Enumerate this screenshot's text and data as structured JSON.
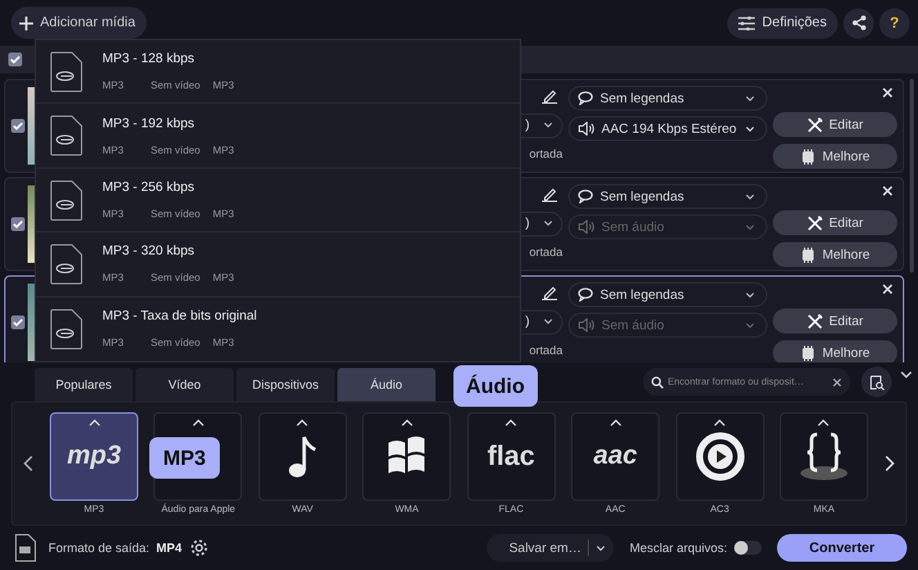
{
  "toolbar": {
    "add_button": "Adicionar mídia",
    "settings_button": "Definições",
    "help_button": "?"
  },
  "header": {
    "select_all_checked": true
  },
  "files": [
    {
      "checked": true,
      "selected": false,
      "video_partial": ")",
      "status_partial": "ortada",
      "subtitles": "Sem legendas",
      "audio": "AAC 194 Kbps Estéreo",
      "audio_disabled": false,
      "edit_button": "Editar",
      "enhance_button": "Melhore"
    },
    {
      "checked": true,
      "selected": false,
      "video_partial": ")",
      "status_partial": "ortada",
      "subtitles": "Sem legendas",
      "audio": "Sem áudio",
      "audio_disabled": true,
      "edit_button": "Editar",
      "enhance_button": "Melhore"
    },
    {
      "checked": true,
      "selected": true,
      "video_partial": ")",
      "status_partial": "ortada",
      "subtitles": "Sem legendas",
      "audio": "Sem áudio",
      "audio_disabled": true,
      "edit_button": "Editar",
      "enhance_button": "Melhore"
    }
  ],
  "preset_menu": [
    {
      "title": "MP3 - 128 kbps",
      "format": "MP3",
      "video": "Sem vídeo",
      "audio": "MP3"
    },
    {
      "title": "MP3 - 192 kbps",
      "format": "MP3",
      "video": "Sem vídeo",
      "audio": "MP3"
    },
    {
      "title": "MP3 - 256 kbps",
      "format": "MP3",
      "video": "Sem vídeo",
      "audio": "MP3"
    },
    {
      "title": "MP3 - 320 kbps",
      "format": "MP3",
      "video": "Sem vídeo",
      "audio": "MP3"
    },
    {
      "title": "MP3 - Taxa de bits original",
      "format": "MP3",
      "video": "Sem vídeo",
      "audio": "MP3"
    }
  ],
  "format_tabs": [
    {
      "label": "Populares",
      "selected": false
    },
    {
      "label": "Vídeo",
      "selected": false
    },
    {
      "label": "Dispositivos",
      "selected": false
    },
    {
      "label": "Áudio",
      "selected": true
    }
  ],
  "tab_tooltip": "Áudio",
  "search": {
    "placeholder": "Encontrar formato ou disposit…"
  },
  "formats": [
    {
      "label": "MP3",
      "kind": "logo",
      "logo_text": "mp3",
      "selected": true
    },
    {
      "label": "Áudio para Apple",
      "kind": "apple",
      "selected": false
    },
    {
      "label": "WAV",
      "kind": "note",
      "selected": false
    },
    {
      "label": "WMA",
      "kind": "windows",
      "selected": false
    },
    {
      "label": "FLAC",
      "kind": "logo",
      "logo_text": "flac",
      "selected": false
    },
    {
      "label": "AAC",
      "kind": "logo",
      "logo_text": "aac",
      "selected": false
    },
    {
      "label": "AC3",
      "kind": "play",
      "selected": false
    },
    {
      "label": "MKA",
      "kind": "braces",
      "selected": false
    }
  ],
  "format_tooltip": "MP3",
  "footer": {
    "output_label": "Formato de saída:",
    "output_value": "MP4",
    "save_button": "Salvar em…",
    "merge_label": "Mesclar arquivos:",
    "merge_on": false,
    "convert_button": "Converter"
  }
}
